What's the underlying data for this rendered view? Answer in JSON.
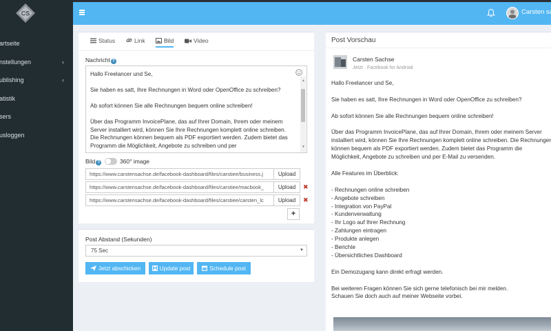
{
  "sidebar": {
    "items": [
      {
        "label": "artseite",
        "chevron": false
      },
      {
        "label": "nstellungen",
        "chevron": true
      },
      {
        "label": "ublishing",
        "chevron": true
      },
      {
        "label": "atistik",
        "chevron": false
      },
      {
        "label": "sers",
        "chevron": false
      },
      {
        "label": "usloggen",
        "chevron": false
      }
    ],
    "chevron_glyph": "‹"
  },
  "topbar": {
    "username": "Carsten sachse",
    "accent_color": "#52b6f3"
  },
  "composer": {
    "tabs": [
      {
        "label": "Status",
        "icon": "list-icon"
      },
      {
        "label": "Link",
        "icon": "link-icon"
      },
      {
        "label": "Bild",
        "icon": "image-icon",
        "active": true
      },
      {
        "label": "Video",
        "icon": "video-icon"
      }
    ],
    "message_label": "Nachricht",
    "help_glyph": "?",
    "message_paragraphs": [
      "Hallo Freelancer und Se,",
      "Sie haben es satt, Ihre Rechnungen in Word oder OpenOffice zu schreiben?",
      "Ab sofort können Sie alle Rechnungen bequem online schreiben!",
      "Über das Programm InvoicePlane, das auf Ihrer Domain, Ihrem oder meinem Server installiert wird, können Sie Ihre Rechnungen komplett online schreiben. Die Rechnungen können bequem als PDF exportiert werden. Zudem bietet das Programm die Möglichkeit, Angebote zu schreiben und per"
    ],
    "bild_label": "Bild",
    "image_360_label": "360° image",
    "image_urls": [
      {
        "value": "https://www.carstensachse.de/facebook-dashboard/files/carstiee/business.j",
        "removable": false
      },
      {
        "value": "https://www.carstensachse.de/facebook-dashboard/files/carstiee/macbook_",
        "removable": true
      },
      {
        "value": "https://www.carstensachse.de/facebook-dashboard/files/carstiee/carsten_lc",
        "removable": true
      }
    ],
    "upload_label": "Upload",
    "remove_glyph": "✖",
    "add_glyph": "+"
  },
  "schedule": {
    "interval_label": "Post Abstand (Sekunden)",
    "interval_value": "75 Sec",
    "buttons": {
      "send_now": "Jetzt abschicken",
      "update": "Update post",
      "schedule": "Schedule post"
    }
  },
  "preview": {
    "title": "Post Vorschau",
    "author": "Carsten Sachse",
    "meta": "Jetzt · Facebook for Android",
    "paragraphs": [
      "Hallo Freelancer und Se,",
      "Sie haben es satt, Ihre Rechnungen in Word oder OpenOffice zu schreiben?",
      "Ab sofort können Sie alle Rechnungen bequem online schreiben!",
      "Über das Programm InvoicePlane, das auf Ihrer Domain, Ihrem oder meinem Server installiert wird, können Sie Ihre Rechnungen komplett online schreiben. Die Rechnungen können bequem als PDF exportiert werden. Zudem bietet das Programm die Möglichkeit, Angebote zu schreiben und per E-Mail zu versenden.",
      "Alle Features im Überblick:",
      "- Rechnungen online schreiben\n- Angebote schreiben\n- Integration von PayPal\n- Kundenverwaltung\n- Ihr Logo auf Ihrer Rechnung\n- Zahlungen eintragen\n- Produkte anlegen\n- Berichte\n- Übersichtliches Dashboard",
      "Ein Demozugang kann direkt erfragt werden.",
      "Bei weiteren Fragen können Sie sich gerne telefonisch bei mir melden.\nSchauen Sie doch auch auf meiner Webseite vorbei."
    ]
  }
}
